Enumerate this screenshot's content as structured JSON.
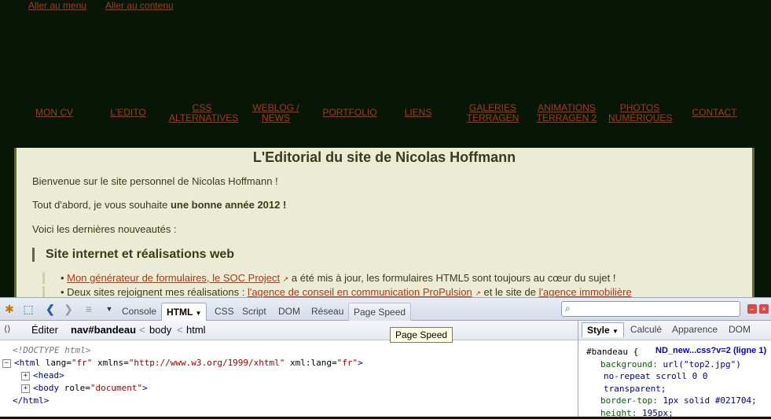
{
  "site": {
    "skip_links": [
      "Aller au menu",
      "Aller au contenu"
    ],
    "nav": [
      {
        "label": "MON CV"
      },
      {
        "label": "L'EDITO"
      },
      {
        "label": "CSS",
        "label2": "ALTERNATIVES"
      },
      {
        "label": "WEBLOG /",
        "label2": "NEWS"
      },
      {
        "label": "PORTFOLIO"
      },
      {
        "label": "LIENS"
      },
      {
        "label": "GALERIES",
        "label2": "TERRAGEN"
      },
      {
        "label": "ANIMATIONS",
        "label2": "TERRAGEN 2"
      },
      {
        "label": "PHOTOS",
        "label2": "NUMÉRIQUES"
      },
      {
        "label": "CONTACT"
      }
    ],
    "title": "L'Editorial du site de Nicolas Hoffmann",
    "p1": "Bienvenue sur le site personnel de Nicolas Hoffmann !",
    "p2_prefix": "Tout d'abord, je vous souhaite ",
    "p2_bold": "une bonne année 2012 !",
    "p3": "Voici les dernières nouveautés :",
    "h2": "Site internet et réalisations web",
    "li1_link": "Mon générateur de formulaires, le SOC Project",
    "li1_rest": " a été mis à jour, les formulaires HTML5 sont toujours au cœur du sujet !",
    "li2_prefix": "Deux sites rejoignent mes réalisations : ",
    "li2_link1": "l'agence de conseil en communication ProPulsion",
    "li2_mid": " et le site de ",
    "li2_link2": "l'agence immobilière"
  },
  "firebug": {
    "tabs": {
      "console": "Console",
      "html": "HTML",
      "css": "CSS",
      "script": "Script",
      "dom": "DOM",
      "reseau": "Réseau",
      "pagespeed": "Page Speed"
    },
    "search_placeholder": "",
    "breadcrumb": {
      "edit": "Éditer",
      "current": "nav#bandeau",
      "sep": "<",
      "body": "body",
      "html": "html"
    },
    "code": {
      "doctype": "<!DOCTYPE html>",
      "html_tag_open": "<html",
      "lang_attr": " lang=",
      "lang_val": "\"fr\"",
      "xmlns_attr": " xmlns=",
      "xmlns_val": "\"http://www.w3.org/1999/xhtml\"",
      "xmllang_attr": " xml:lang=",
      "xmllang_val": "\"fr\"",
      "gt": ">",
      "head": "<head>",
      "body_open": "<body",
      "role_attr": " role=",
      "role_val": "\"document\"",
      "html_close": "</html>"
    },
    "side_tabs": {
      "style": "Style",
      "calcule": "Calculé",
      "apparence": "Apparence",
      "dom": "DOM"
    },
    "css_rule": {
      "selector": "#bandeau {",
      "source": "ND_new...css?v=2 (ligne 1)",
      "l1_prop": "background:",
      "l1_val": " url(\"top2.jpg\")",
      "l2": "no-repeat scroll 0 0",
      "l3": "transparent;",
      "l4_prop": "border-top:",
      "l4_val": " 1px solid #021704;",
      "l5_prop": "height:",
      "l5_val": " 195px;"
    },
    "tooltip": "Page Speed"
  }
}
